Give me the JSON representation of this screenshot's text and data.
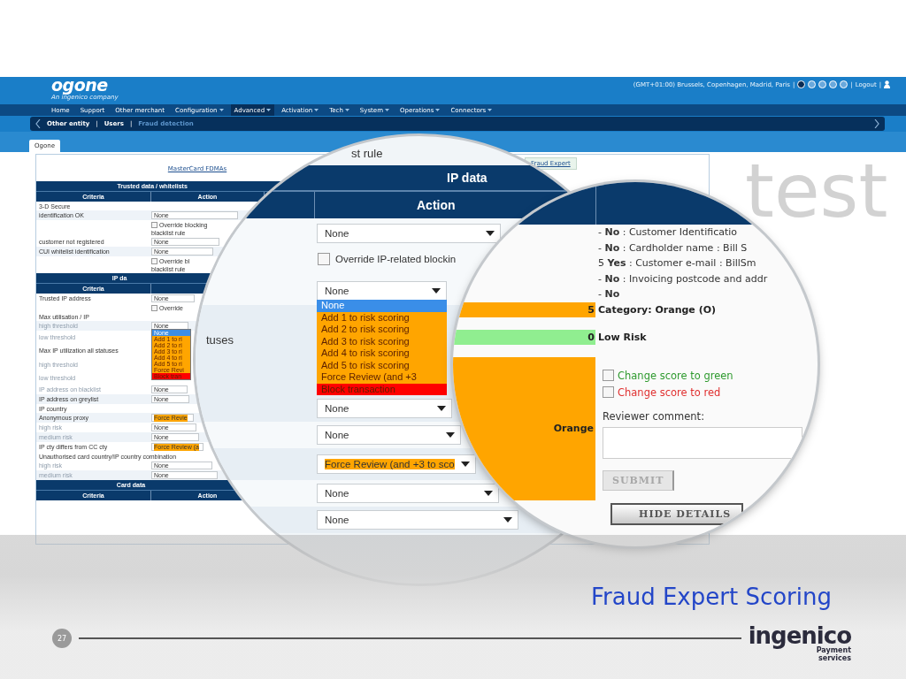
{
  "header": {
    "logo": "ogone",
    "tagline": "An ingenico company",
    "timezone": "(GMT+01:00) Brussels, Copenhagen, Madrid, Paris",
    "separator": "|",
    "languages": [
      {
        "selected": true
      },
      {
        "selected": false
      },
      {
        "selected": false
      },
      {
        "selected": false
      },
      {
        "selected": false
      }
    ],
    "logout": "Logout"
  },
  "nav": [
    {
      "label": "Home",
      "dropdown": false,
      "selected": false
    },
    {
      "label": "Support",
      "dropdown": false,
      "selected": false
    },
    {
      "label": "Other merchant",
      "dropdown": false,
      "selected": false
    },
    {
      "label": "Configuration",
      "dropdown": true,
      "selected": false
    },
    {
      "label": "Advanced",
      "dropdown": true,
      "selected": true
    },
    {
      "label": "Activation",
      "dropdown": true,
      "selected": false
    },
    {
      "label": "Tech",
      "dropdown": true,
      "selected": false
    },
    {
      "label": "System",
      "dropdown": true,
      "selected": false
    },
    {
      "label": "Operations",
      "dropdown": true,
      "selected": false
    },
    {
      "label": "Connectors",
      "dropdown": true,
      "selected": false
    }
  ],
  "subnav": {
    "separator": "|",
    "items": [
      {
        "label": "Other entity",
        "selected": false
      },
      {
        "label": "Users",
        "selected": false
      },
      {
        "label": "Fraud detection",
        "selected": true
      }
    ]
  },
  "tabs": [
    {
      "label": "Ogone",
      "selected": true
    }
  ],
  "environment": "test",
  "links": [
    "MasterCard FDMAs",
    "Fraud Expert"
  ],
  "table": {
    "rows": [
      {
        "kind": "section",
        "text": "Trusted data / whitelists"
      },
      {
        "kind": "columns",
        "criteria": "Criteria",
        "action": "Action"
      },
      {
        "kind": "label",
        "text": "3-D Secure",
        "disabled": false
      },
      {
        "kind": "field",
        "label": "identification OK",
        "disabled": false,
        "value": "None"
      },
      {
        "kind": "checkbox",
        "text": "Override blocking",
        "checked": false
      },
      {
        "kind": "note",
        "text": "blacklist rule"
      },
      {
        "kind": "field",
        "label": "customer not registered",
        "disabled": false,
        "value": "None"
      },
      {
        "kind": "field",
        "label": "CUI whitelist identification",
        "disabled": false,
        "value": "None"
      },
      {
        "kind": "checkbox",
        "text": "Override bl",
        "checked": false
      },
      {
        "kind": "note",
        "text": "blacklist rule"
      },
      {
        "kind": "section",
        "text": "IP da"
      },
      {
        "kind": "columns",
        "criteria": "Criteria"
      },
      {
        "kind": "field",
        "label": "Trusted IP address",
        "disabled": false,
        "value": "None"
      },
      {
        "kind": "checkbox",
        "text": "Override",
        "checked": false
      },
      {
        "kind": "label",
        "text": "Max utilisation / IP",
        "disabled": false
      },
      {
        "kind": "field",
        "label": "high threshold",
        "disabled": true,
        "value": "None",
        "options": [
          {
            "label": "None",
            "selected": true
          },
          {
            "label": "Add 1 to ri",
            "selected": false,
            "color": "#ffa500"
          },
          {
            "label": "Add 2 to ri",
            "selected": false,
            "color": "#ffa500"
          },
          {
            "label": "Add 3 to ri",
            "selected": false,
            "color": "#ffa500"
          },
          {
            "label": "Add 4 to ri",
            "selected": false,
            "color": "#ffa500"
          },
          {
            "label": "Add 5 to ri",
            "selected": false,
            "color": "#ffa500"
          },
          {
            "label": "Force Revi",
            "selected": false,
            "color": "#ffa500"
          },
          {
            "label": "Block tran",
            "selected": false,
            "color": "#ff0000"
          }
        ]
      },
      {
        "kind": "label",
        "text": "low threshold",
        "disabled": true
      },
      {
        "kind": "label",
        "text": "Max IP utilization all statuses",
        "disabled": false
      },
      {
        "kind": "label",
        "text": "high threshold",
        "disabled": true
      },
      {
        "kind": "label",
        "text": "low threshold",
        "disabled": true
      },
      {
        "kind": "field",
        "label": "IP address on blacklist",
        "disabled": true,
        "value": "None"
      },
      {
        "kind": "field",
        "label": "IP address on greylist",
        "disabled": false,
        "value": "None"
      },
      {
        "kind": "label",
        "text": "IP country",
        "disabled": false
      },
      {
        "kind": "field",
        "label": "Anonymous proxy",
        "disabled": false,
        "value": "Force Revie",
        "color": "#ffa500"
      },
      {
        "kind": "field",
        "label": "high risk",
        "disabled": true,
        "value": "None"
      },
      {
        "kind": "field",
        "label": "medium risk",
        "disabled": true,
        "value": "None"
      },
      {
        "kind": "field",
        "label": "IP cty differs from CC cty",
        "disabled": false,
        "value": "Force Review (a",
        "color": "#ffa500"
      },
      {
        "kind": "label",
        "text": "Unauthorised card country/IP country combination",
        "disabled": false
      },
      {
        "kind": "field",
        "label": "high risk",
        "disabled": true,
        "value": "None"
      },
      {
        "kind": "field",
        "label": "medium risk",
        "disabled": true,
        "value": "None"
      },
      {
        "kind": "section",
        "text": "Card data"
      },
      {
        "kind": "columns",
        "criteria": "Criteria",
        "action": "Action"
      }
    ]
  },
  "magnifier_1": {
    "caption": "st rule",
    "section": "IP data",
    "action_header": "Action",
    "rows": [
      {
        "kind": "field",
        "value": "None"
      },
      {
        "kind": "checkbox",
        "text": "Override IP-related blockin",
        "checked": false
      },
      {
        "kind": "field",
        "value": "None",
        "options": [
          {
            "label": "None",
            "selected": true
          },
          {
            "label": "Add 1 to risk scoring",
            "selected": false,
            "color": "#ffa500"
          },
          {
            "label": "Add 2 to risk scoring",
            "selected": false,
            "color": "#ffa500"
          },
          {
            "label": "Add 3 to risk scoring",
            "selected": false,
            "color": "#ffa500"
          },
          {
            "label": "Add 4 to risk scoring",
            "selected": false,
            "color": "#ffa500"
          },
          {
            "label": "Add 5 to risk scoring",
            "selected": false,
            "color": "#ffa500"
          },
          {
            "label": "Force Review (and +3",
            "selected": false,
            "color": "#ffa500"
          },
          {
            "label": "Block transaction",
            "selected": false,
            "color": "#ff0000"
          }
        ]
      },
      {
        "kind": "field",
        "label": "tuses",
        "value": "None"
      },
      {
        "kind": "field",
        "value": "None"
      },
      {
        "kind": "field",
        "value": "Force Review (and +3 to sco",
        "color": "#ffa500"
      },
      {
        "kind": "field",
        "value": "None"
      },
      {
        "kind": "field",
        "value": "None"
      }
    ]
  },
  "magnifier_2": {
    "rows": [
      "- **No** : Customer Identificatio",
      "- **No** : Cardholder name : Bill S",
      "5 **Yes** : Customer e-mail : BillSm",
      "- **No** : Invoicing postcode and addr",
      "- **No**"
    ],
    "score_rows": [
      {
        "score": "5",
        "text": "Category: Orange (O)",
        "color": "#ffa500"
      },
      {
        "score": "0",
        "text": "Low Risk",
        "color": "#90ee90"
      }
    ],
    "result": "Orange",
    "options": [
      {
        "text": "Change score to green",
        "checked": false,
        "color": "#2e9a2e"
      },
      {
        "text": "Change score to red",
        "checked": false,
        "color": "#e03030"
      }
    ],
    "comment_label": "Reviewer comment:",
    "submit": {
      "label": "SUBMIT",
      "disabled": true
    },
    "hide_button": "HIDE DETAILS"
  },
  "footer": {
    "title": "Fraud Expert Scoring",
    "page": "27",
    "brand": "ingenico",
    "brand_tagline": "Payment services"
  }
}
